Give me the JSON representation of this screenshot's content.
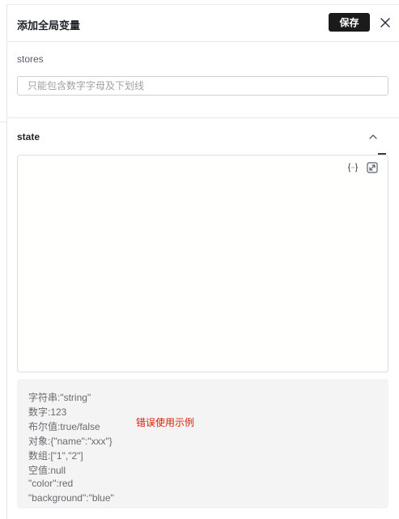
{
  "header": {
    "title": "添加全局变量",
    "save_label": "保存",
    "close_icon": "close-icon"
  },
  "store": {
    "label": "stores",
    "placeholder": "只能包含数字字母及下划线",
    "value": ""
  },
  "state": {
    "label": "state",
    "collapse_icon": "chevron-up-icon",
    "editor_value": "",
    "toolbar_icons": [
      "format-braces-icon",
      "expand-icon"
    ]
  },
  "examples": {
    "lines": [
      "字符串:\"string\"",
      "数字:123",
      "布尔值:true/false",
      "对象:{\"name\":\"xxx\"}",
      "数组:[\"1\",\"2\"]",
      "空值:null",
      "\"color\":red",
      "\"background\":\"blue\""
    ],
    "error_note": "错误使用示例"
  },
  "colors": {
    "save_button_bg": "#1b1b1b",
    "error_text": "#d81e06",
    "example_bg": "#f4f4f4"
  }
}
